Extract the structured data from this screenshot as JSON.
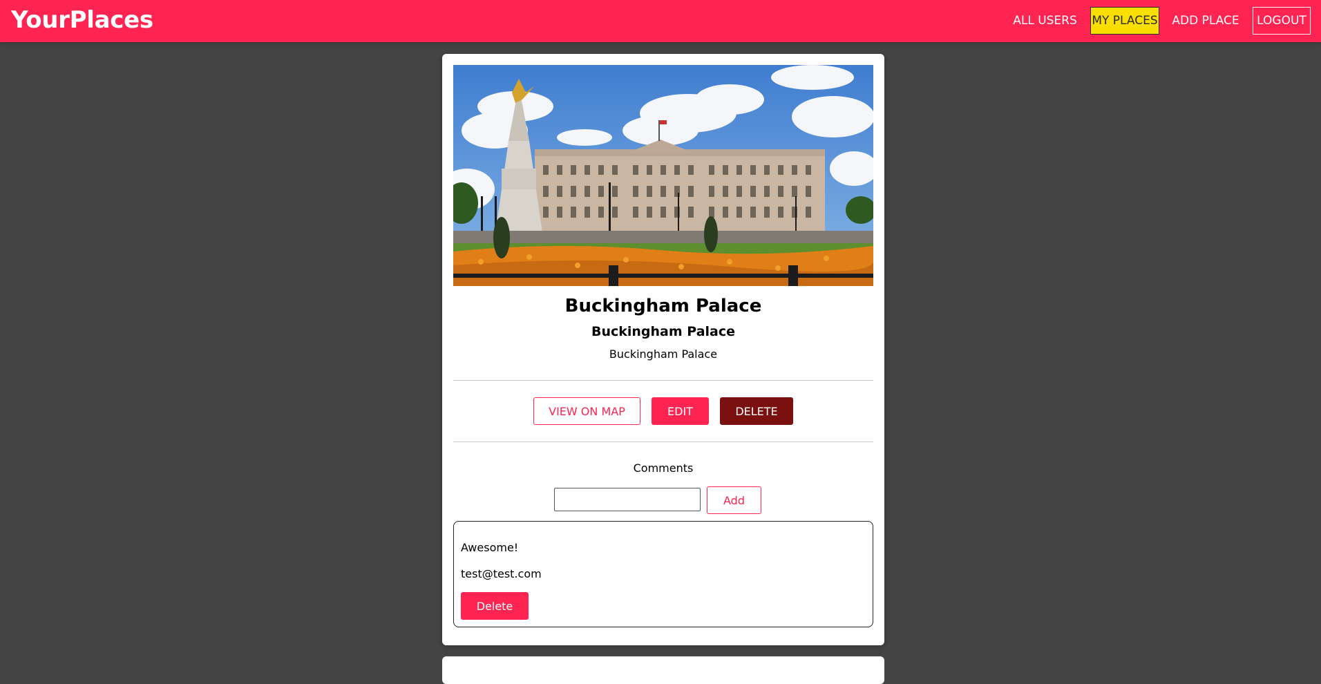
{
  "header": {
    "logo": "YourPlaces",
    "nav": [
      {
        "label": "ALL USERS"
      },
      {
        "label": "MY PLACES"
      },
      {
        "label": "ADD PLACE"
      },
      {
        "label": "LOGOUT"
      }
    ]
  },
  "place": {
    "image_alt": "Buckingham Palace",
    "title": "Buckingham Palace",
    "address": "Buckingham Palace",
    "description": "Buckingham Palace",
    "actions": {
      "view_on_map": "VIEW ON MAP",
      "edit": "EDIT",
      "delete": "DELETE"
    }
  },
  "comments": {
    "label": "Comments",
    "input_value": "",
    "add_label": "Add",
    "items": [
      {
        "text": "Awesome!",
        "author": "test@test.com",
        "delete_label": "Delete"
      }
    ]
  },
  "colors": {
    "brand": "#ff2451",
    "active_nav": "#f8df00",
    "danger": "#7a1010",
    "background": "#444444"
  }
}
